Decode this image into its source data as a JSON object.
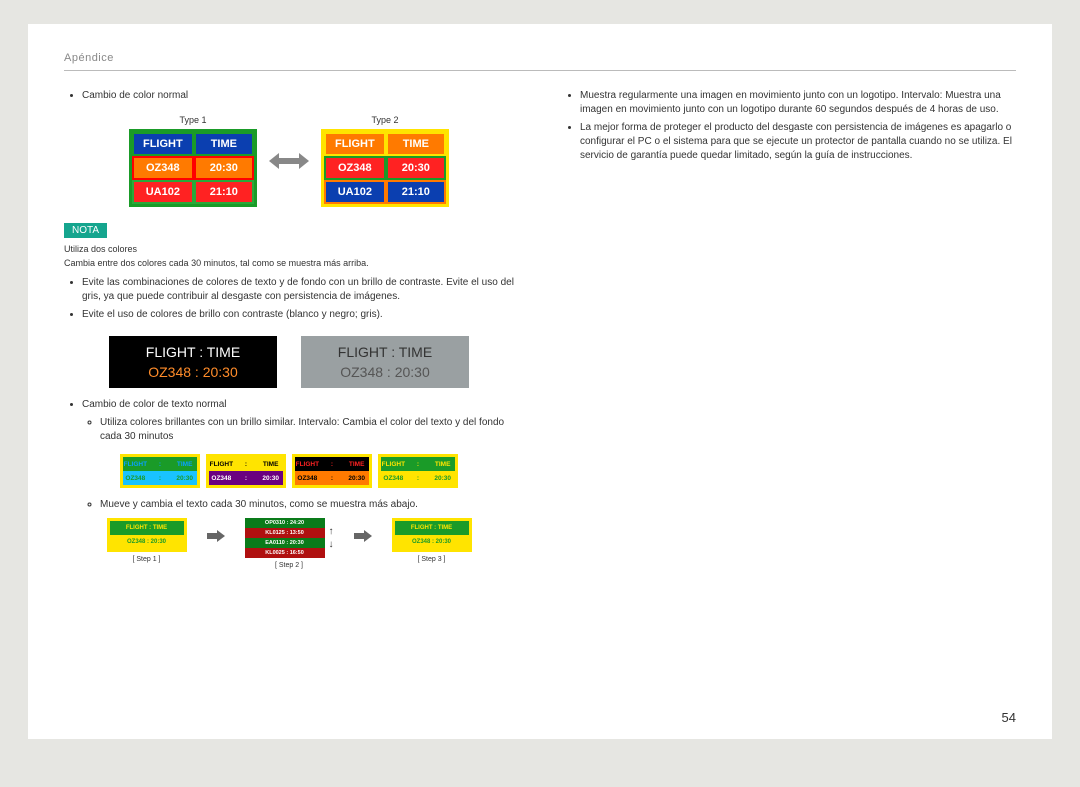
{
  "header": {
    "title": "Apéndice"
  },
  "page_number": "54",
  "left": {
    "bullet1": "Cambio de color normal",
    "type1_label": "Type 1",
    "type2_label": "Type 2",
    "type_boards": {
      "rows": [
        {
          "c1": "FLIGHT",
          "c2": "TIME"
        },
        {
          "c1": "OZ348",
          "c2": "20:30"
        },
        {
          "c1": "UA102",
          "c2": "21:10"
        }
      ]
    },
    "nota_badge": "NOTA",
    "nota_line1": "Utiliza dos colores",
    "nota_line2": "Cambia entre dos colores cada 30 minutos, tal como se muestra más arriba.",
    "bullet2": "Evite las combinaciones de colores de texto y de fondo con un brillo de contraste. Evite el uso del gris, ya que puede contribuir al desgaste con persistencia de imágenes.",
    "bullet3": "Evite el uso de colores de brillo con contraste (blanco y negro; gris).",
    "plate_r1": "FLIGHT   :   TIME",
    "plate_r2": "OZ348    :   20:30",
    "bullet4": "Cambio de color de texto normal",
    "sub4a": "Utiliza colores brillantes con un brillo similar. Intervalo: Cambia el color del texto y del fondo cada 30 minutos",
    "strips": [
      {
        "bg1": "#1a9b28",
        "fg1": "#09a0ff",
        "bg2": "#19c3ff",
        "fg2": "#1a9b28",
        "r1a": "FLIGHT",
        "r1b": "TIME",
        "r2a": "OZ348",
        "r2b": "20:30"
      },
      {
        "bg1": "#ffe400",
        "fg1": "#000000",
        "bg2": "#6a0080",
        "fg2": "#ffffff",
        "r1a": "FLIGHT",
        "r1b": "TIME",
        "r2a": "OZ348",
        "r2b": "20:30"
      },
      {
        "bg1": "#000000",
        "fg1": "#ff2222",
        "bg2": "#ff7a00",
        "fg2": "#000000",
        "r1a": "FLIGHT",
        "r1b": "TIME",
        "r2a": "OZ348",
        "r2b": "20:30"
      },
      {
        "bg1": "#1a9b28",
        "fg1": "#ffe400",
        "bg2": "#ffe400",
        "fg2": "#1a9b28",
        "r1a": "FLIGHT",
        "r1b": "TIME",
        "r2a": "OZ348",
        "r2b": "20:30"
      }
    ],
    "sub4b": "Mueve y cambia el texto cada 30 minutos, como se muestra más abajo.",
    "steps": {
      "s1": {
        "label": "[ Step 1 ]",
        "r1": "FLIGHT   :   TIME",
        "r2": "OZ348   :   20:30"
      },
      "s2": {
        "label": "[ Step 2 ]",
        "l0": "OP0310  :  24:20",
        "l1": "KL0125  :  13:50",
        "l2": "EA0110  :  20:30",
        "l3": "KL0025  :  16:50"
      },
      "s3": {
        "label": "[ Step 3 ]",
        "r1": "FLIGHT   :   TIME",
        "r2": "OZ348   :   20:30"
      }
    }
  },
  "right": {
    "bullet1": "Muestra regularmente una imagen en movimiento junto con un logotipo. Intervalo: Muestra una imagen en movimiento junto con un logotipo durante 60 segundos después de 4 horas de uso.",
    "bullet2": "La mejor forma de proteger el producto del desgaste con persistencia de imágenes es apagarlo o configurar el PC o el sistema para que se ejecute un protector de pantalla cuando no se utiliza. El servicio de garantía puede quedar limitado, según la guía de instrucciones."
  }
}
